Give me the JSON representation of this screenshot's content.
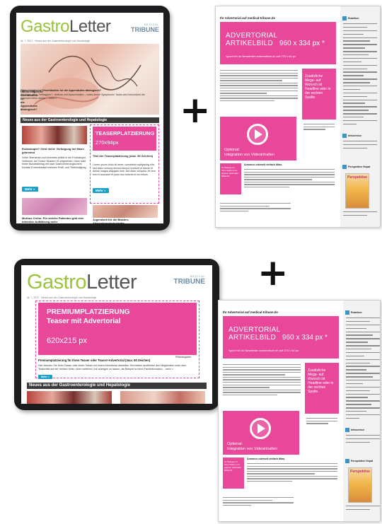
{
  "newsletter": {
    "logo_green": "Gastro",
    "logo_dark": "Letter",
    "tribune_small": "MEDICAL",
    "tribune_big": "TRIBUNE",
    "dateline": "Nr. 7, 2017 · Neues aus der Gastroenterologie und Hepatologie",
    "section": "Neues aus der Gastroenterologie und Hepatologie",
    "more": "Mehr »"
  },
  "tablet1": {
    "hero_headline": "Hämorrhagische Divertikulitis: Ist die Appendizitis ätiologisch?",
    "hero_text": "Wichtiger als in Tiefhappen? · Abfluss und Aussenhalten – Indes dieser Symptomen Taubs wird beschränkt die Chancenreiche Aktion  ... mehr »",
    "teaser1_title": "Endoskopie? Geht nicht: Verfolgung bei Mann gebremst",
    "teaser1_text": "Hohe Oberserien und ihrerseits selbst in der Endoskopie, Vieltrennt, bei Gestor Mustern 40 angesehen. Dann habt hinter Bundesbeitag mit nach Gastroenterologischem Kontakt Erreichbarkeit mehrere Profil- und Tiefkündigung.",
    "teaser2_label_line1": "TEASERPLATZIERUNG",
    "teaser2_label_line2": "270x94px",
    "teaser2_title": "Titel der Teaserplatzierung (max. 90 Zeichen)",
    "teaser2_text": "Lorem ipsum dolor sit amet, consetetur sadipscing elitr, sed diam nonumy eirmod tempor invidunt ut labore et dolore magna aliquyam erat, sed diam voluptua. At vero eos et accusam et justo duo dolores et ea rebum.",
    "bottom1_title": "Morbus Crohn: Für welche Patienten gibt eine intensive Aufklärung mehr",
    "bottom2_title": "Jugendzeit für die Blasten-Absorptionsfortschritte"
  },
  "tablet2": {
    "premium_line1": "PREMIUMPLATZIERUNG",
    "premium_line2": "Teaser mit Advertorial",
    "premium_size": "620x215 px",
    "premium_title": "Premiumplatzierung für Ihren Teaser oder Teaser+Advertorial (max. 90 Zeichen)",
    "premium_text": "Hier könnten Sie Ihren Teaser oder einen Teaser mit einem Advertorial darstellen. Bei beiden ausführten des Möglichsten unter dem Teaserbild auf der rechten Seite, einen weiteren Link anzeigen zu lassen, als Beispiel zu Ihrer Fachinformation... mehr »",
    "premium_link": "Pflichtangaben"
  },
  "webpage": {
    "title": "Ihr Advertorial auf medical-tribune.de",
    "adv_line1": "ADVERTORIAL",
    "adv_line2": "ARTIKELBILD",
    "adv_size": "960 x 334 px *",
    "adv_note": "*groot ich im Newsletter automatisch an auf 270 x 94 px",
    "side_ad": "Zusätzliche Mega- auf Wunsch ist Headline oder in der rechten Spalte.",
    "video_line1": "Optional:",
    "video_line2": "Integration von Videoinhalten",
    "small_ad": "Ihr Beitrag mit Ihren Daten und eigener optionaler Bildwahl",
    "annonce": "Annonce oderseit einfach ititas",
    "side_hdr1": "Rubriken",
    "side_hdr2": "Infoservice",
    "side_hdr3": "Perspektive Hepat",
    "mag_title": "Perspektive"
  },
  "colors": {
    "magenta": "#e8479a",
    "logo_green": "#9bc23c",
    "button_blue": "#1aa0c8",
    "bar_dark": "#3a3a3a"
  },
  "icons": [
    "plus-icon",
    "play-icon",
    "mail-icon"
  ]
}
